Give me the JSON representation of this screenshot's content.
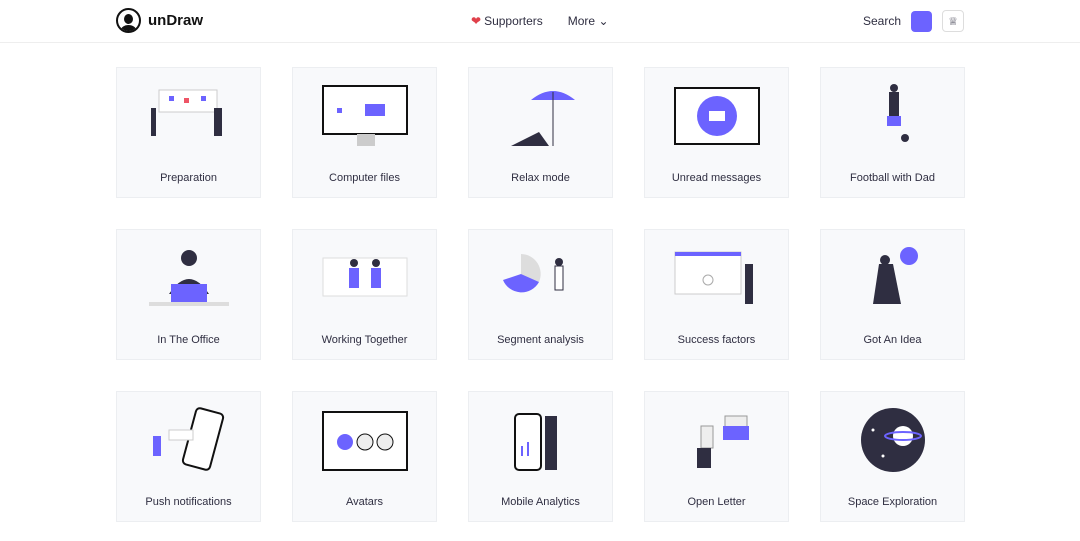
{
  "header": {
    "brand": "unDraw",
    "nav": [
      {
        "label": "Supporters",
        "icon": "heart-icon"
      },
      {
        "label": "More",
        "icon": "chevron-down-icon"
      }
    ],
    "search_label": "Search",
    "accent": "#6c63ff"
  },
  "illustrations": [
    {
      "label": "Preparation"
    },
    {
      "label": "Computer files"
    },
    {
      "label": "Relax mode"
    },
    {
      "label": "Unread messages"
    },
    {
      "label": "Football with Dad"
    },
    {
      "label": "In The Office"
    },
    {
      "label": "Working Together"
    },
    {
      "label": "Segment analysis"
    },
    {
      "label": "Success factors"
    },
    {
      "label": "Got An Idea"
    },
    {
      "label": "Push notifications"
    },
    {
      "label": "Avatars"
    },
    {
      "label": "Mobile Analytics"
    },
    {
      "label": "Open Letter"
    },
    {
      "label": "Space Exploration"
    }
  ]
}
